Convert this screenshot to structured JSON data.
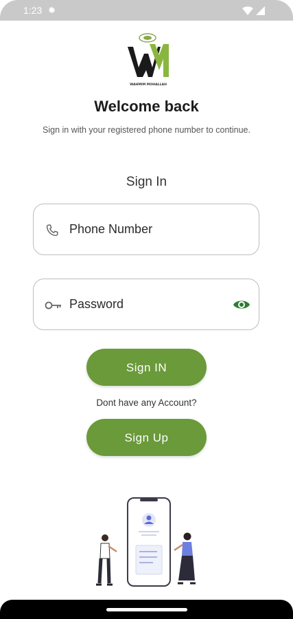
{
  "status_bar": {
    "time": "1:23",
    "settings_icon": "gear-icon",
    "wifi_icon": "wifi-icon",
    "signal_icon": "signal-icon"
  },
  "logo": {
    "brand_text": "WAHMIM MOHALLAH",
    "icon": "wm-logo-icon"
  },
  "header": {
    "title": "Welcome back",
    "subtitle": "Sign in with your registered phone number to continue."
  },
  "form": {
    "heading": "Sign In",
    "phone_placeholder": "Phone Number",
    "phone_icon": "phone-icon",
    "password_placeholder": "Password",
    "password_icon": "key-icon",
    "toggle_visibility_icon": "eye-icon",
    "signin_label": "Sign IN",
    "no_account_text": "Dont have any Account?",
    "signup_label": "Sign Up"
  },
  "colors": {
    "accent": "#6a9a3a",
    "eye": "#2e7d32",
    "status_bar": "#c9c9c9"
  }
}
